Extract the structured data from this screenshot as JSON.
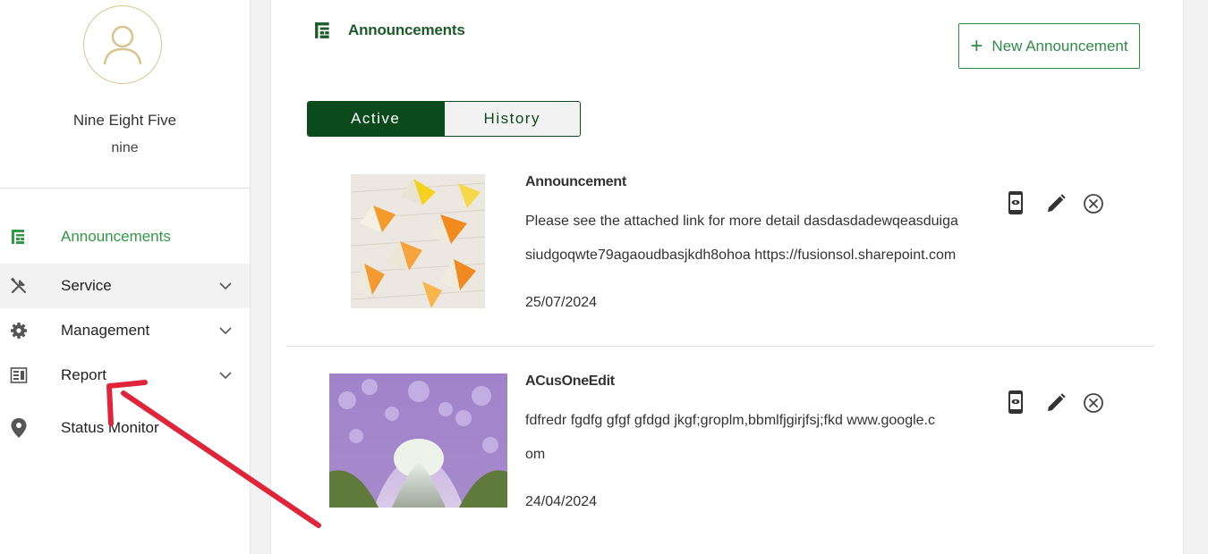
{
  "user": {
    "name": "Nine Eight Five",
    "handle": "nine"
  },
  "nav": {
    "items": [
      {
        "label": "Announcements",
        "icon": "announcement-icon"
      },
      {
        "label": "Service",
        "icon": "tools-icon"
      },
      {
        "label": "Management",
        "icon": "gear-icon"
      },
      {
        "label": "Report",
        "icon": "report-icon"
      },
      {
        "label": "Status Monitor",
        "icon": "location-pin-icon"
      }
    ]
  },
  "main": {
    "title": "Announcements",
    "new_button_label": "New Announcement",
    "tabs": [
      {
        "label": "Active"
      },
      {
        "label": "History"
      }
    ],
    "announcements": [
      {
        "title": "Announcement",
        "body_line1": "Please see the attached link for more detail dasdasdadewqeasduiga",
        "body_line2": "siudgoqwte79agaoudbasjkdh8ohoa  https://fusionsol.sharepoint.com",
        "date": "25/07/2024"
      },
      {
        "title": "ACusOneEdit",
        "body_line1": "fdfredr fgdfg gfgf gfdgd jkgf;groplm,bbmlfjgirjfsj;fkd www.google.c",
        "body_line2": "om",
        "date": "24/04/2024"
      }
    ]
  },
  "colors": {
    "accent_green": "#2f9a44",
    "dark_green": "#0a4a1b",
    "annotation_red": "#e0243a",
    "avatar_gold": "#d8c48e"
  }
}
